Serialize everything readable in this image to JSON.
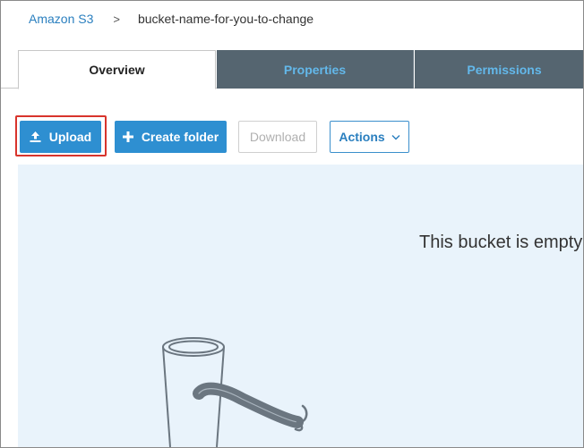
{
  "breadcrumb": {
    "root": "Amazon S3",
    "separator": ">",
    "current": "bucket-name-for-you-to-change"
  },
  "tabs": [
    {
      "label": "Overview",
      "active": true
    },
    {
      "label": "Properties",
      "active": false
    },
    {
      "label": "Permissions",
      "active": false
    }
  ],
  "toolbar": {
    "upload_label": "Upload",
    "create_folder_label": "Create folder",
    "download_label": "Download",
    "actions_label": "Actions",
    "upload_icon": "upload-icon",
    "create_folder_icon": "plus-icon",
    "actions_icon": "chevron-down-icon"
  },
  "main": {
    "empty_message": "This bucket is empty"
  },
  "colors": {
    "accent": "#2e8fd1",
    "tab_inactive_bg": "#556570",
    "tab_inactive_text": "#63b8ea",
    "highlight": "#d8342c",
    "panel_bg": "#e9f3fb"
  }
}
